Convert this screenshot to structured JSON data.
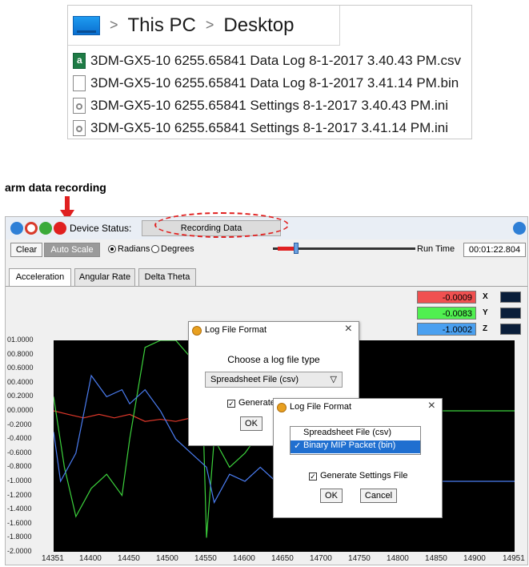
{
  "explorer": {
    "crumbs": [
      "This PC",
      "Desktop"
    ],
    "files": [
      {
        "name": "3DM-GX5-10 6255.65841 Data Log 8-1-2017 3.40.43 PM.csv",
        "icon": "spreadsheet-file-icon"
      },
      {
        "name": "3DM-GX5-10 6255.65841 Data Log 8-1-2017 3.41.14 PM.bin",
        "icon": "blank-file-icon"
      },
      {
        "name": "3DM-GX5-10 6255.65841 Settings 8-1-2017 3.40.43 PM.ini",
        "icon": "settings-file-icon"
      },
      {
        "name": "3DM-GX5-10 6255.65841 Settings 8-1-2017 3.41.14 PM.ini",
        "icon": "settings-file-icon"
      }
    ]
  },
  "annotation": {
    "label": "arm data recording",
    "color": "#e02020"
  },
  "app": {
    "device_status_label": "Device Status:",
    "device_status": "Recording Data",
    "clear_label": "Clear",
    "auto_scale_label": "Auto Scale",
    "radians_label": "Radians",
    "degrees_label": "Degrees",
    "run_time_label": "Run Time",
    "run_time": "00:01:22.804",
    "tabs": [
      "Acceleration",
      "Angular Rate",
      "Delta Theta"
    ],
    "legend": [
      {
        "value": "-0.0009",
        "axis": "X",
        "color": "#f04040"
      },
      {
        "value": "-0.0083",
        "axis": "Y",
        "color": "#3cdc3c"
      },
      {
        "value": "-1.0002",
        "axis": "Z",
        "color": "#3c8cf0"
      }
    ]
  },
  "chart_data": {
    "type": "line",
    "y_ticks": [
      "01.0000",
      "00.8000",
      "00.6000",
      "00.4000",
      "00.2000",
      "00.0000",
      "-0.2000",
      "-0.4000",
      "-0.6000",
      "-0.8000",
      "-1.0000",
      "-1.2000",
      "-1.4000",
      "-1.6000",
      "-1.8000",
      "-2.0000"
    ],
    "x_ticks": [
      "14351",
      "14400",
      "14450",
      "14500",
      "14550",
      "14600",
      "14650",
      "14700",
      "14750",
      "14800",
      "14850",
      "14900",
      "14951"
    ],
    "xlim": [
      14351,
      14951
    ],
    "ylim": [
      -2.0,
      1.0
    ],
    "series": [
      {
        "name": "X",
        "color": "#e0382a",
        "x": [
          14351,
          14370,
          14390,
          14410,
          14430,
          14450,
          14470,
          14490,
          14510,
          14530,
          14550,
          14560,
          14580,
          14600,
          14620,
          14640,
          14660,
          14680,
          14700
        ],
        "y": [
          0.0,
          -0.05,
          -0.1,
          -0.05,
          -0.1,
          -0.05,
          -0.15,
          -0.12,
          -0.15,
          -0.1,
          -0.15,
          0.1,
          -0.2,
          -0.1,
          -0.2,
          -0.15,
          -0.1,
          -0.15,
          -0.12
        ]
      },
      {
        "name": "Y",
        "color": "#3cd23c",
        "x": [
          14351,
          14365,
          14380,
          14400,
          14420,
          14440,
          14450,
          14470,
          14490,
          14510,
          14530,
          14545,
          14550,
          14560,
          14580,
          14600,
          14620,
          14640,
          14660,
          14680,
          14700,
          14951
        ],
        "y": [
          0.2,
          -0.8,
          -1.5,
          -1.1,
          -0.9,
          -1.2,
          -0.4,
          0.9,
          1.0,
          1.0,
          0.75,
          0.1,
          -1.8,
          -0.4,
          -0.8,
          -0.6,
          -0.3,
          -0.15,
          -0.5,
          -0.1,
          0.0,
          0.0
        ]
      },
      {
        "name": "Z",
        "color": "#4a7cf0",
        "x": [
          14351,
          14360,
          14380,
          14400,
          14420,
          14440,
          14450,
          14470,
          14490,
          14510,
          14530,
          14550,
          14560,
          14580,
          14600,
          14620,
          14640,
          14660,
          14680,
          14700,
          14951
        ],
        "y": [
          -0.3,
          -1.0,
          -0.6,
          0.5,
          0.2,
          0.3,
          0.1,
          0.3,
          0.0,
          -0.4,
          -0.6,
          -0.8,
          -1.3,
          -0.9,
          -1.0,
          -0.8,
          -1.0,
          -0.9,
          -1.0,
          -1.0,
          -1.0
        ]
      }
    ]
  },
  "dialog1": {
    "title": "Log File Format",
    "prompt": "Choose a log file type",
    "selection": "Spreadsheet File (csv)",
    "generate_label": "Generate",
    "ok_label": "OK"
  },
  "dialog2": {
    "title": "Log File Format",
    "options": [
      "Spreadsheet File (csv)",
      "Binary MIP Packet (bin)"
    ],
    "selected_check": "✓",
    "generate_label": "Generate Settings File",
    "ok_label": "OK",
    "cancel_label": "Cancel"
  }
}
